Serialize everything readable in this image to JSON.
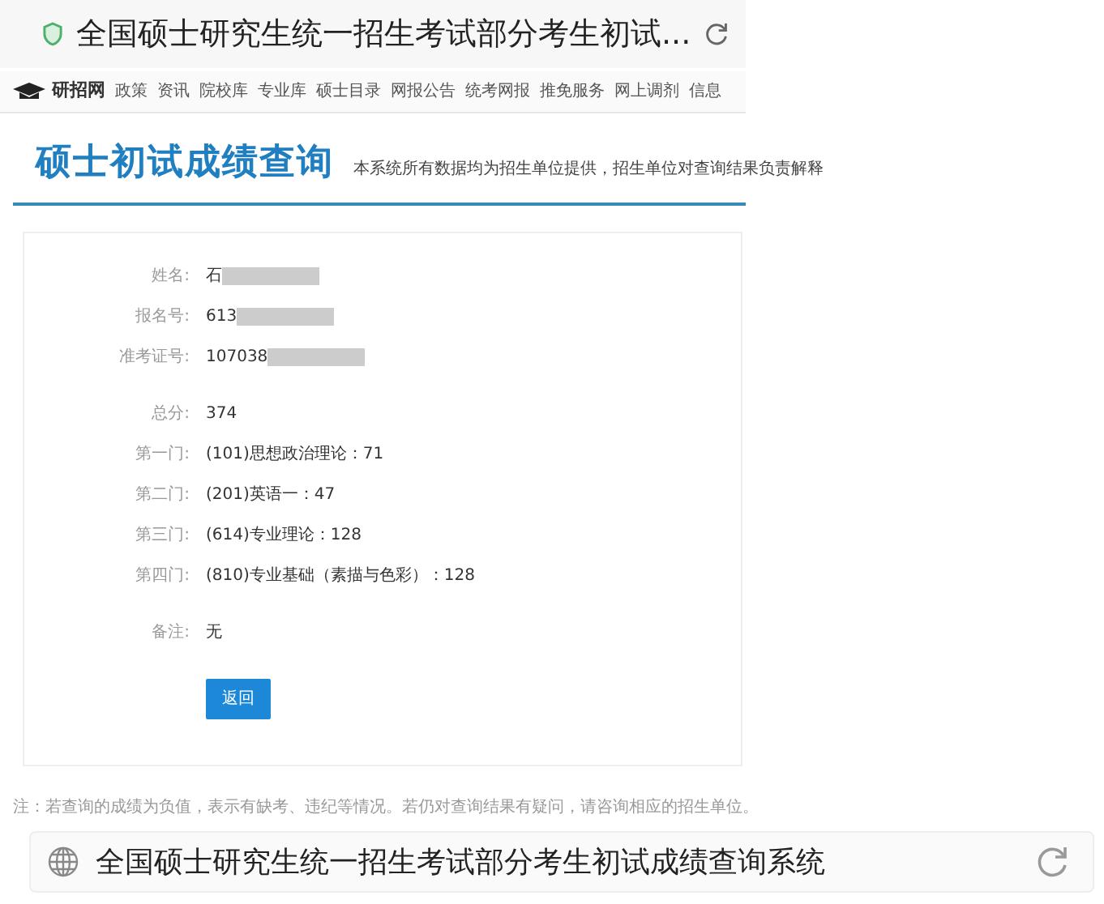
{
  "top_bar": {
    "title": "全国硕士研究生统一招生考试部分考生初试..."
  },
  "nav": {
    "logo": "研招网",
    "items": [
      "政策",
      "资讯",
      "院校库",
      "专业库",
      "硕士目录",
      "网报公告",
      "统考网报",
      "推免服务",
      "网上调剂",
      "信息"
    ]
  },
  "header": {
    "title": "硕士初试成绩查询",
    "subtitle": "本系统所有数据均为招生单位提供，招生单位对查询结果负责解释"
  },
  "result": {
    "groups": [
      [
        {
          "label": "姓名:",
          "value": "石",
          "redacted": true
        },
        {
          "label": "报名号:",
          "value": "613",
          "redacted": true
        },
        {
          "label": "准考证号:",
          "value": "107038",
          "redacted": true
        }
      ],
      [
        {
          "label": "总分:",
          "value": "374",
          "redacted": false
        },
        {
          "label": "第一门:",
          "value": "(101)思想政治理论：71",
          "redacted": false
        },
        {
          "label": "第二门:",
          "value": "(201)英语一：47",
          "redacted": false
        },
        {
          "label": "第三门:",
          "value": "(614)专业理论：128",
          "redacted": false
        },
        {
          "label": "第四门:",
          "value": "(810)专业基础（素描与色彩）：128",
          "redacted": false
        }
      ],
      [
        {
          "label": "备注:",
          "value": "无",
          "redacted": false
        }
      ]
    ],
    "button": "返回"
  },
  "note": "注：若查询的成绩为负值，表示有缺考、违纪等情况。若仍对查询结果有疑问，请咨询相应的招生单位。",
  "bottom_bar": {
    "title": "全国硕士研究生统一招生考试部分考生初试成绩查询系统"
  }
}
